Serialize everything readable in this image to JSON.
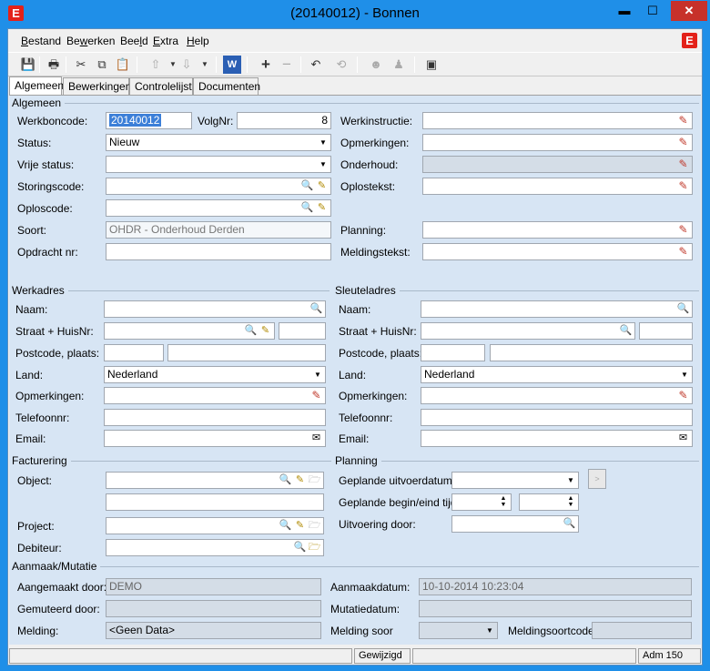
{
  "window": {
    "title": "(20140012) - Bonnen",
    "minimize": "▬",
    "maximize": "☐",
    "close": "✕"
  },
  "app_logo": "E",
  "menu": {
    "items": [
      {
        "pre": "",
        "u": "B",
        "post": "estand"
      },
      {
        "pre": "Be",
        "u": "w",
        "post": "erken"
      },
      {
        "pre": "Bee",
        "u": "l",
        "post": "d"
      },
      {
        "pre": "",
        "u": "E",
        "post": "xtra"
      },
      {
        "pre": "",
        "u": "H",
        "post": "elp"
      }
    ]
  },
  "toolbar": [
    "save-icon",
    "print-icon",
    "cut-icon",
    "copy-icon",
    "paste-icon",
    "nav-up-icon",
    "nav-down-icon",
    "word-icon",
    "add-icon",
    "remove-icon",
    "undo-icon",
    "refresh-icon",
    "person-icon",
    "figure-icon",
    "window-icon"
  ],
  "tabs": [
    "Algemeen",
    "Bewerkingen",
    "Controlelijst",
    "Documenten"
  ],
  "algemeen": {
    "group": "Algemeen",
    "werkboncode_label": "Werkboncode:",
    "werkboncode": "20140012",
    "volgnr_label": "VolgNr:",
    "volgnr": "8",
    "status_label": "Status:",
    "status": "Nieuw",
    "vrije_status_label": "Vrije status:",
    "storingscode_label": "Storingscode:",
    "oploscode_label": "Oploscode:",
    "soort_label": "Soort:",
    "soort": "OHDR - Onderhoud Derden",
    "opdracht_label": "Opdracht nr:",
    "werkinstructie_label": "Werkinstructie:",
    "opmerkingen_label": "Opmerkingen:",
    "onderhoud_label": "Onderhoud:",
    "oplostekst_label": "Oplostekst:",
    "planning_label": "Planning:",
    "meldingstekst_label": "Meldingstekst:"
  },
  "werkadres": {
    "group": "Werkadres",
    "naam_label": "Naam:",
    "straat_label": "Straat + HuisNr:",
    "postcode_label": "Postcode, plaats:",
    "land_label": "Land:",
    "land": "Nederland",
    "opmerkingen_label": "Opmerkingen:",
    "telefoon_label": "Telefoonnr:",
    "email_label": "Email:"
  },
  "sleuteladres": {
    "group": "Sleuteladres",
    "naam_label": "Naam:",
    "straat_label": "Straat + HuisNr:",
    "postcode_label": "Postcode, plaats:",
    "land_label": "Land:",
    "land": "Nederland",
    "opmerkingen_label": "Opmerkingen:",
    "telefoon_label": "Telefoonnr:",
    "email_label": "Email:"
  },
  "facturering": {
    "group": "Facturering",
    "object_label": "Object:",
    "project_label": "Project:",
    "debiteur_label": "Debiteur:"
  },
  "planning": {
    "group": "Planning",
    "uitvoerdatum_label": "Geplande uitvoerdatum:",
    "begin_eind_label": "Geplande begin/eind tijd:",
    "uitvoering_label": "Uitvoering door:"
  },
  "mutatie": {
    "group": "Aanmaak/Mutatie",
    "aangemaakt_label": "Aangemaakt door:",
    "aangemaakt": "DEMO",
    "aanmaakdatum_label": "Aanmaakdatum:",
    "aanmaakdatum": "10-10-2014 10:23:04",
    "gemuteerd_label": "Gemuteerd door:",
    "mutatiedatum_label": "Mutatiedatum:",
    "melding_label": "Melding:",
    "melding": "<Geen Data>",
    "melding_soort_label": "Melding soor",
    "meldingsoortcode_label": "Meldingsoortcode:"
  },
  "status": {
    "state": "Gewijzigd",
    "user": "Adm 150"
  }
}
